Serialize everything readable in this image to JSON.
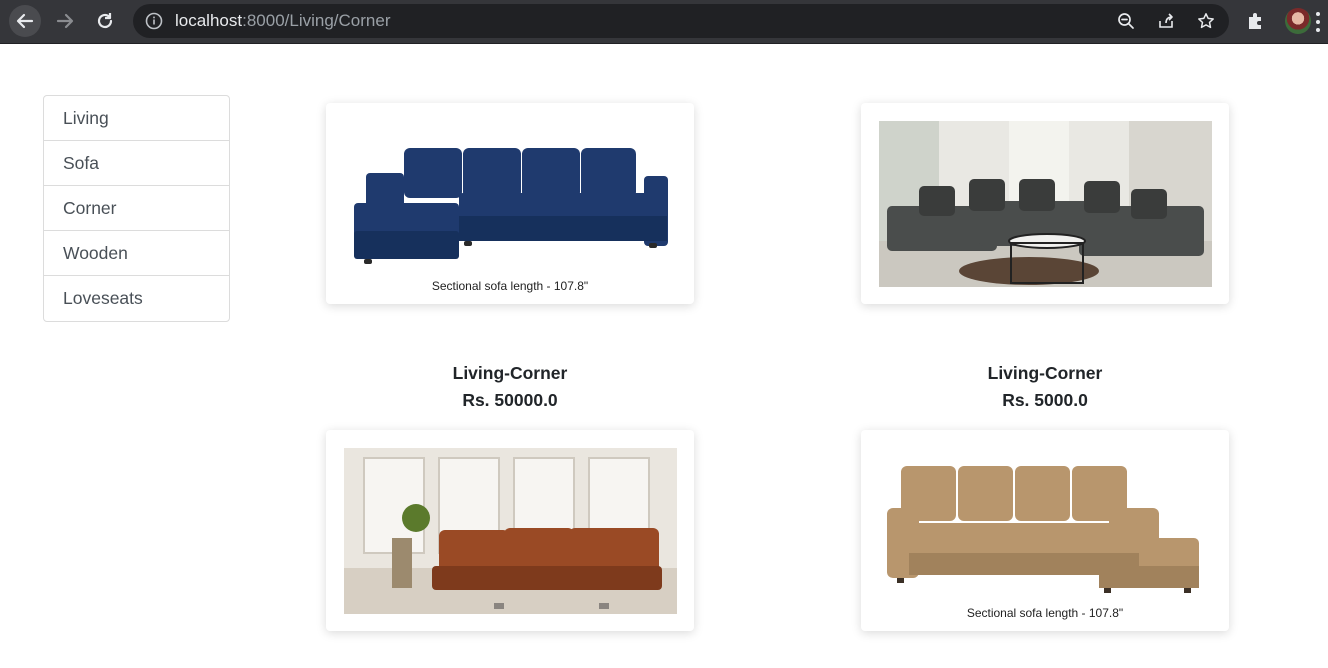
{
  "browser": {
    "url_host": "localhost",
    "url_path": ":8000/Living/Corner",
    "icons": [
      "back-arrow-icon",
      "forward-arrow-icon",
      "reload-icon",
      "info-icon",
      "zoom-out-icon",
      "share-icon",
      "star-icon",
      "extensions-puzzle-icon",
      "profile-avatar",
      "more-menu-icon"
    ]
  },
  "sidebar": {
    "items": [
      {
        "label": "Living"
      },
      {
        "label": "Sofa"
      },
      {
        "label": "Corner"
      },
      {
        "label": "Wooden"
      },
      {
        "label": "Loveseats"
      }
    ]
  },
  "products": [
    {
      "note": "Sectional sofa length - 107.8\"",
      "sofa_color": "#1f3a6e"
    },
    {
      "title": "Living-Corner",
      "price": "Rs. 5000.0",
      "sofa_color": "#4a4d4c"
    },
    {
      "sofa_color": "#9a4a25"
    },
    {
      "note": "Sectional sofa length - 107.8\"",
      "sofa_color": "#b8966d"
    }
  ],
  "captions": [
    {
      "title": "Living-Corner",
      "price": "Rs. 50000.0"
    },
    {
      "title": "Living-Corner",
      "price": "Rs. 5000.0"
    }
  ]
}
